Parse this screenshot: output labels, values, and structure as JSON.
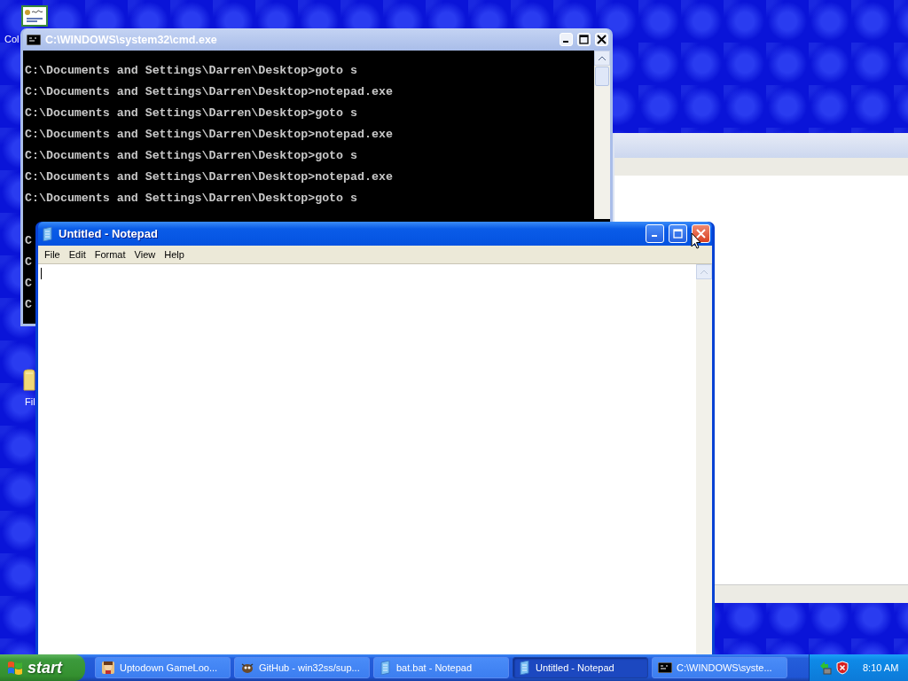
{
  "desktop": {
    "icons": [
      {
        "label": "Col",
        "kind": "certificate"
      },
      {
        "label": "Fil",
        "kind": "folder"
      }
    ]
  },
  "cmd_window": {
    "title": "C:\\WINDOWS\\system32\\cmd.exe",
    "lines": [
      "C:\\Documents and Settings\\Darren\\Desktop>goto s",
      "C:\\Documents and Settings\\Darren\\Desktop>notepad.exe",
      "C:\\Documents and Settings\\Darren\\Desktop>goto s",
      "C:\\Documents and Settings\\Darren\\Desktop>notepad.exe",
      "C:\\Documents and Settings\\Darren\\Desktop>goto s",
      "C:\\Documents and Settings\\Darren\\Desktop>notepad.exe",
      "C:\\Documents and Settings\\Darren\\Desktop>goto s"
    ],
    "covered_lines": [
      "C",
      "C",
      "C",
      "C"
    ]
  },
  "notepad": {
    "title": "Untitled - Notepad",
    "menu": [
      "File",
      "Edit",
      "Format",
      "View",
      "Help"
    ]
  },
  "taskbar": {
    "start": "start",
    "buttons": [
      {
        "label": "Uptodown GameLoo...",
        "kind": "game",
        "selected": false
      },
      {
        "label": "GitHub - win32ss/sup...",
        "kind": "browser",
        "selected": false
      },
      {
        "label": "bat.bat - Notepad",
        "kind": "notepad",
        "selected": false
      },
      {
        "label": "Untitled - Notepad",
        "kind": "notepad",
        "selected": true
      },
      {
        "label": "C:\\WINDOWS\\syste...",
        "kind": "console",
        "selected": false
      }
    ],
    "clock": "8:10 AM"
  }
}
